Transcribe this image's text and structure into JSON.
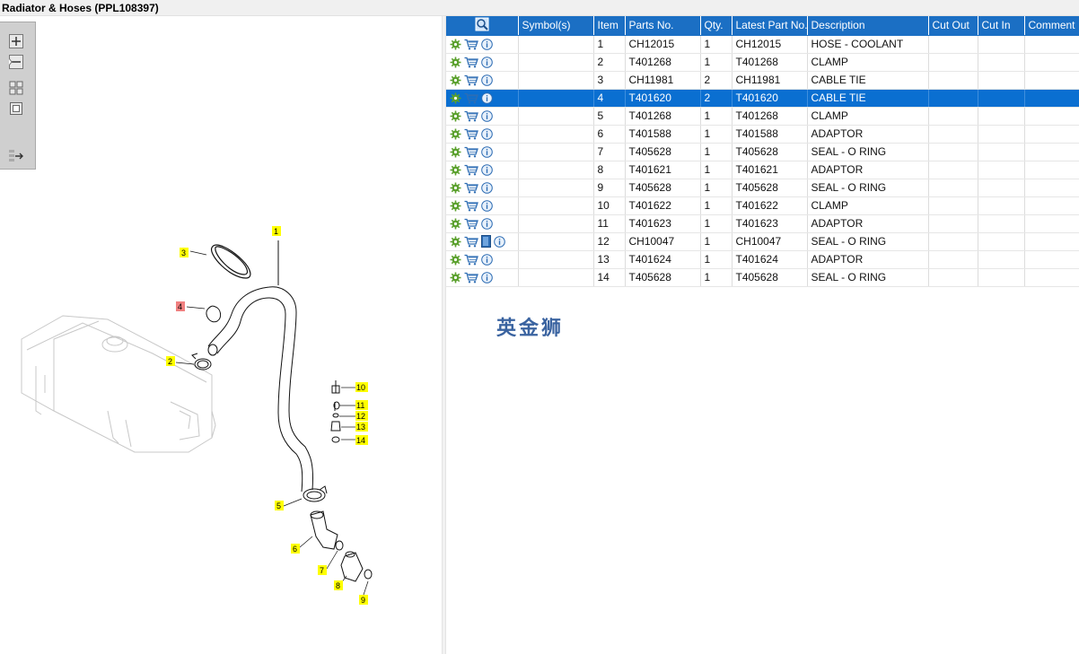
{
  "title": "Radiator & Hoses (PPL108397)",
  "toolbar": {
    "zoom_in": "zoom-in-icon",
    "zoom_out": "zoom-out-icon",
    "fit_all": "fit-all-icon",
    "fit_window": "fit-window-icon",
    "export": "export-icon"
  },
  "diagram": {
    "callouts": [
      {
        "label": "1",
        "highlight": "#ffff00"
      },
      {
        "label": "2",
        "highlight": "#ffff00"
      },
      {
        "label": "3",
        "highlight": "#ffff00"
      },
      {
        "label": "4",
        "highlight": "#f08080"
      },
      {
        "label": "5",
        "highlight": "#ffff00"
      },
      {
        "label": "6",
        "highlight": "#ffff00"
      },
      {
        "label": "7",
        "highlight": "#ffff00"
      },
      {
        "label": "8",
        "highlight": "#ffff00"
      },
      {
        "label": "9",
        "highlight": "#ffff00"
      },
      {
        "label": "10",
        "highlight": "#ffff00"
      },
      {
        "label": "11",
        "highlight": "#ffff00"
      },
      {
        "label": "12",
        "highlight": "#ffff00"
      },
      {
        "label": "13",
        "highlight": "#ffff00"
      },
      {
        "label": "14",
        "highlight": "#ffff00"
      }
    ]
  },
  "table": {
    "columns": [
      "",
      "Symbol(s)",
      "Item",
      "Parts No.",
      "Qty.",
      "Latest Part No.",
      "Description",
      "Cut Out",
      "Cut In",
      "Comment"
    ],
    "selected_row": 3,
    "rows": [
      {
        "item": "1",
        "part": "CH12015",
        "qty": "1",
        "latest": "CH12015",
        "desc": "HOSE - COOLANT",
        "doc": false
      },
      {
        "item": "2",
        "part": "T401268",
        "qty": "1",
        "latest": "T401268",
        "desc": "CLAMP",
        "doc": false
      },
      {
        "item": "3",
        "part": "CH11981",
        "qty": "2",
        "latest": "CH11981",
        "desc": "CABLE TIE",
        "doc": false
      },
      {
        "item": "4",
        "part": "T401620",
        "qty": "2",
        "latest": "T401620",
        "desc": "CABLE TIE",
        "doc": false
      },
      {
        "item": "5",
        "part": "T401268",
        "qty": "1",
        "latest": "T401268",
        "desc": "CLAMP",
        "doc": false
      },
      {
        "item": "6",
        "part": "T401588",
        "qty": "1",
        "latest": "T401588",
        "desc": "ADAPTOR",
        "doc": false
      },
      {
        "item": "7",
        "part": "T405628",
        "qty": "1",
        "latest": "T405628",
        "desc": "SEAL - O RING",
        "doc": false
      },
      {
        "item": "8",
        "part": "T401621",
        "qty": "1",
        "latest": "T401621",
        "desc": "ADAPTOR",
        "doc": false
      },
      {
        "item": "9",
        "part": "T405628",
        "qty": "1",
        "latest": "T405628",
        "desc": "SEAL - O RING",
        "doc": false
      },
      {
        "item": "10",
        "part": "T401622",
        "qty": "1",
        "latest": "T401622",
        "desc": "CLAMP",
        "doc": false
      },
      {
        "item": "11",
        "part": "T401623",
        "qty": "1",
        "latest": "T401623",
        "desc": "ADAPTOR",
        "doc": false
      },
      {
        "item": "12",
        "part": "CH10047",
        "qty": "1",
        "latest": "CH10047",
        "desc": "SEAL - O RING",
        "doc": true
      },
      {
        "item": "13",
        "part": "T401624",
        "qty": "1",
        "latest": "T401624",
        "desc": "ADAPTOR",
        "doc": false
      },
      {
        "item": "14",
        "part": "T405628",
        "qty": "1",
        "latest": "T405628",
        "desc": "SEAL - O RING",
        "doc": false
      }
    ]
  },
  "watermark": "英金狮",
  "colors": {
    "header": "#1b6fc4",
    "selected": "#0a6fd1",
    "gear": "#5aa02c",
    "cart": "#2e6db4",
    "info": "#2e6db4"
  }
}
